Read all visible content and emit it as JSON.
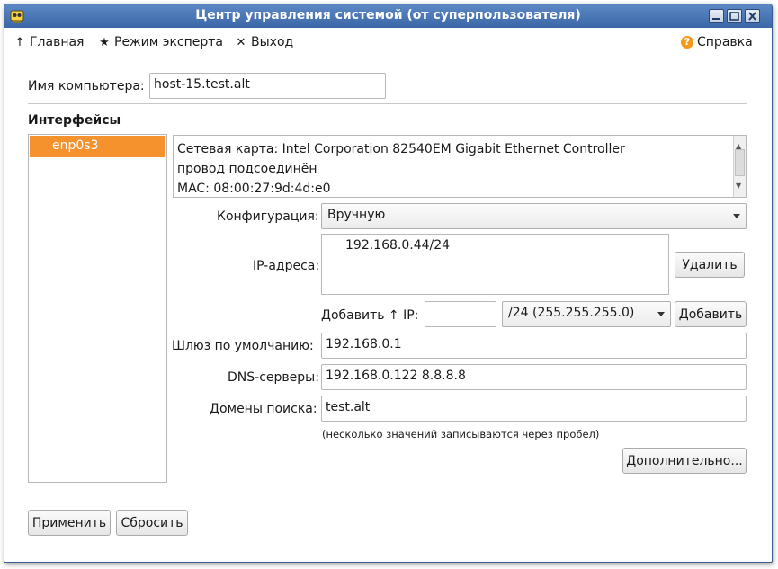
{
  "window": {
    "title": "Центр управления системой (от суперпользователя)"
  },
  "toolbar": {
    "home": {
      "icon": "arrow-up-icon",
      "label": "Главная"
    },
    "expert": {
      "icon": "star-icon",
      "label": "Режим эксперта"
    },
    "exit": {
      "icon": "close-x-icon",
      "label": "Выход"
    },
    "help": {
      "icon": "help-icon",
      "label": "Справка"
    }
  },
  "hostname": {
    "label": "Имя компьютера:",
    "value": "host-15.test.alt"
  },
  "interfaces": {
    "title": "Интерфейсы",
    "items": [
      "enp0s3"
    ],
    "selected": "enp0s3"
  },
  "info": {
    "lines": [
      "Сетевая карта: Intel Corporation 82540EM Gigabit Ethernet Controller",
      "провод подсоединён",
      "MAC: 08:00:27:9d:4d:e0"
    ]
  },
  "config": {
    "label": "Конфигурация:",
    "value": "Вручную"
  },
  "ip": {
    "label": "IP-адреса:",
    "addresses": [
      "192.168.0.44/24"
    ],
    "delete_label": "Удалить",
    "add_prefix_label": "Добавить ↑ IP:",
    "new_ip_value": "",
    "mask_value": "/24 (255.255.255.0)",
    "add_label": "Добавить"
  },
  "gateway": {
    "label": "Шлюз по умолчанию:",
    "value": "192.168.0.1"
  },
  "dns": {
    "label": "DNS-серверы:",
    "value": "192.168.0.122 8.8.8.8"
  },
  "search": {
    "label": "Домены поиска:",
    "value": "test.alt",
    "hint": "(несколько значений записываются через пробел)"
  },
  "advanced_label": "Дополнительно...",
  "apply_label": "Применить",
  "reset_label": "Сбросить"
}
